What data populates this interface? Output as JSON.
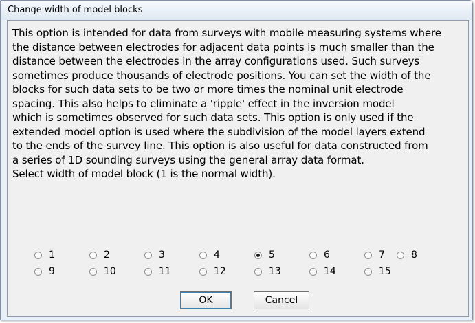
{
  "dialog": {
    "title": "Change width of model blocks",
    "description": "This option is intended for data from surveys with mobile measuring systems where\nthe distance between electrodes for adjacent data points is much smaller than the\ndistance between the electrodes in the array configurations used. Such surveys\nsometimes produce thousands of electrode positions. You can set the width of the\nblocks for such data sets to be two or more times the nominal unit electrode\nspacing. This also helps to eliminate a 'ripple' effect in the inversion model\nwhich is sometimes observed for such data sets. This option is only used if the\nextended model option is used where the subdivision of the model layers extend\nto the ends of the survey line. This option is also useful for data constructed from\na series of 1D sounding surveys using the general array data format.\nSelect width of model block (1 is the normal width).",
    "options": [
      "1",
      "2",
      "3",
      "4",
      "5",
      "6",
      "7",
      "8",
      "9",
      "10",
      "11",
      "12",
      "13",
      "14",
      "15"
    ],
    "selected": "5",
    "ok_label": "OK",
    "cancel_label": "Cancel"
  }
}
